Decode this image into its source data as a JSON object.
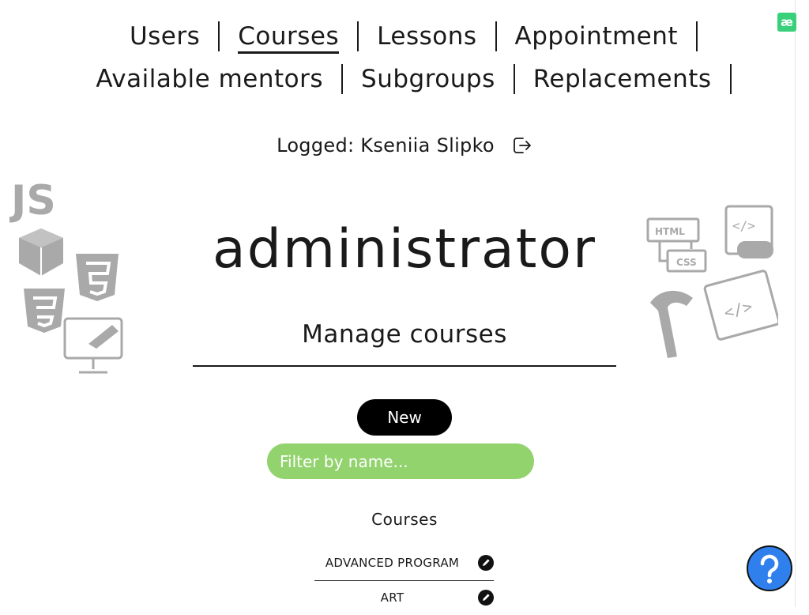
{
  "nav": {
    "items": [
      {
        "label": "Users",
        "active": false
      },
      {
        "label": "Courses",
        "active": true
      },
      {
        "label": "Lessons",
        "active": false
      },
      {
        "label": "Appointment",
        "active": false
      },
      {
        "label": "Available mentors",
        "active": false
      },
      {
        "label": "Subgroups",
        "active": false
      },
      {
        "label": "Replacements",
        "active": false
      }
    ]
  },
  "extension_badge": "æ",
  "session": {
    "logged_text": "Logged: Kseniia Slipko",
    "logout_icon": "logout-icon"
  },
  "role": "administrator",
  "manage": {
    "title": "Manage courses",
    "new_label": "New",
    "filter_placeholder": "Filter by name..."
  },
  "courses": {
    "heading": "Courses",
    "items": [
      {
        "name": "ADVANCED PROGRAM"
      },
      {
        "name": "ART"
      }
    ]
  },
  "help_icon": "question-circle-icon",
  "colors": {
    "accent_green": "#92d36e",
    "help_blue": "#2f80ed",
    "text": "#1a1a1a",
    "decor_gray": "#a9a9a9"
  }
}
